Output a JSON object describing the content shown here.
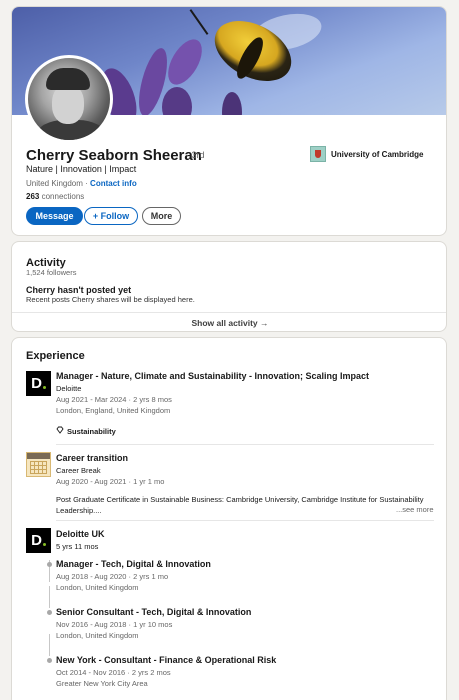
{
  "profile": {
    "name": "Cherry Seaborn Sheeran",
    "degree": "· 3rd",
    "headline": "Nature | Innovation | Impact",
    "location": "United Kingdom ·",
    "contact_info": "Contact info",
    "connections_count": "263",
    "connections_label": "connections",
    "buttons": {
      "message": "Message",
      "follow": "+ Follow",
      "more": "More"
    },
    "education": "University of Cambridge"
  },
  "activity": {
    "title": "Activity",
    "followers": "1,524 followers",
    "empty_title": "Cherry hasn't posted yet",
    "empty_sub": "Recent posts Cherry shares will be displayed here.",
    "show_all": "Show all activity →"
  },
  "experience": {
    "title": "Experience",
    "items": [
      {
        "title": "Manager - Nature, Climate and Sustainability - Innovation; Scaling Impact",
        "company": "Deloitte",
        "dates": "Aug 2021 - Mar 2024 · 2 yrs 8 mos",
        "location": "London, England, United Kingdom",
        "skill": "Sustainability"
      },
      {
        "title": "Career transition",
        "company": "Career Break",
        "dates": "Aug 2020 - Aug 2021 · 1 yr 1 mo",
        "description": "Post Graduate Certificate in Sustainable Business: Cambridge University, Cambridge Institute for Sustainability Leadership....",
        "see_more": "...see more"
      }
    ],
    "group": {
      "company": "Deloitte UK",
      "duration": "5 yrs 11 mos",
      "roles": [
        {
          "title": "Manager - Tech, Digital & Innovation",
          "dates": "Aug 2018 - Aug 2020 · 2 yrs 1 mo",
          "location": "London, United Kingdom"
        },
        {
          "title": "Senior Consultant - Tech, Digital & Innovation",
          "dates": "Nov 2016 - Aug 2018 · 1 yr 10 mos",
          "location": "London, United Kingdom"
        },
        {
          "title": "New York - Consultant - Finance & Operational Risk",
          "dates": "Oct 2014 - Nov 2016 · 2 yrs 2 mos",
          "location": "Greater New York City Area"
        }
      ]
    }
  },
  "colors": {
    "accent": "#0a66c2",
    "deloitte_green": "#86bc25",
    "background": "#f3f2ef"
  },
  "icons": {
    "skill": "diamond-icon",
    "arrow": "arrow-right-icon"
  }
}
